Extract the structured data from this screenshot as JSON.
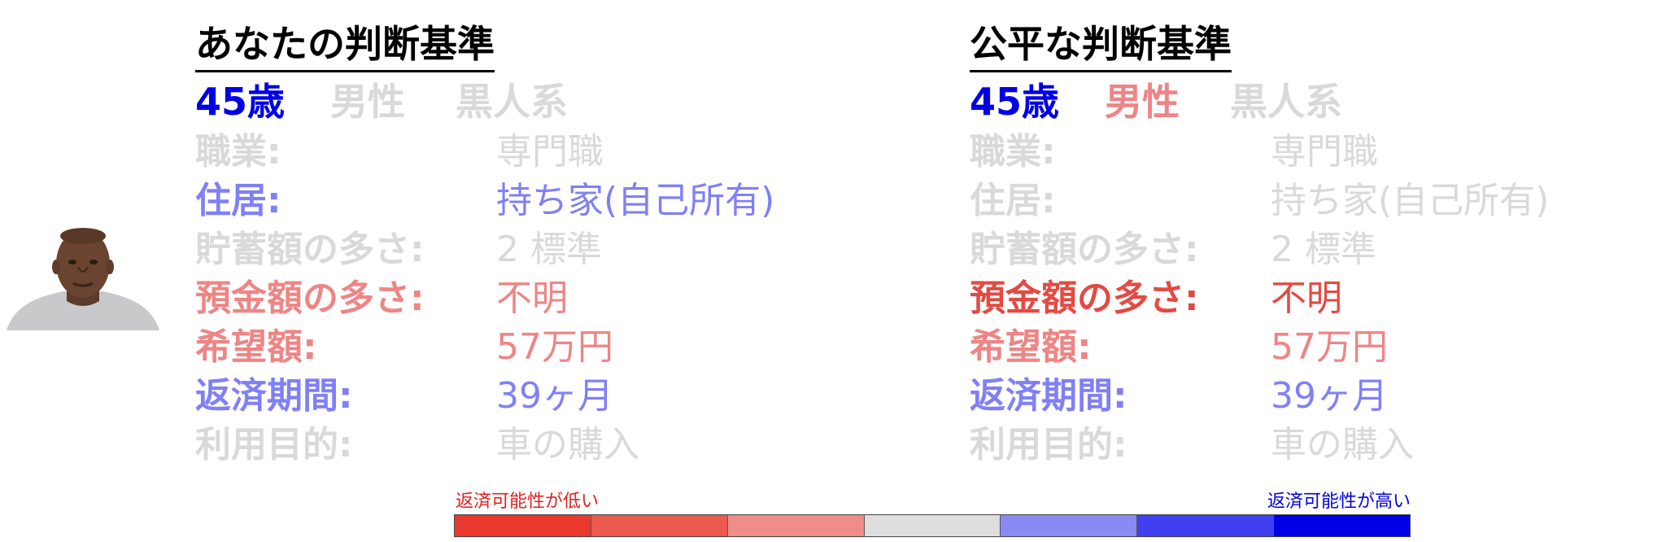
{
  "left_panel": {
    "title": "あなたの判断基準",
    "age": "45歳",
    "sex": "男性",
    "race": "黒人系",
    "rows": [
      {
        "key": "職業:",
        "value": "専門職"
      },
      {
        "key": "住居:",
        "value": "持ち家(自己所有)"
      },
      {
        "key": "貯蓄額の多さ:",
        "value": "2 標準"
      },
      {
        "key": "預金額の多さ:",
        "value": "不明"
      },
      {
        "key": "希望額:",
        "value": "57万円"
      },
      {
        "key": "返済期間:",
        "value": "39ヶ月"
      },
      {
        "key": "利用目的:",
        "value": "車の購入"
      }
    ]
  },
  "right_panel": {
    "title": "公平な判断基準",
    "age": "45歳",
    "sex": "男性",
    "race": "黒人系",
    "rows": [
      {
        "key": "職業:",
        "value": "専門職"
      },
      {
        "key": "住居:",
        "value": "持ち家(自己所有)"
      },
      {
        "key": "貯蓄額の多さ:",
        "value": "2 標準"
      },
      {
        "key": "預金額の多さ:",
        "value": "不明"
      },
      {
        "key": "希望額:",
        "value": "57万円"
      },
      {
        "key": "返済期間:",
        "value": "39ヶ月"
      },
      {
        "key": "利用目的:",
        "value": "車の購入"
      }
    ]
  },
  "scale": {
    "low_label": "返済可能性が低い",
    "high_label": "返済可能性が高い",
    "colors": [
      "#e8392c",
      "#ec5a50",
      "#ef8d88",
      "#dedede",
      "#8a8af5",
      "#4040f0",
      "#0000e6"
    ]
  },
  "colors": {
    "gray": "#d9d9d9",
    "blue": "#0000e6",
    "light_blue": "#8080f5",
    "light_red": "#ee8585",
    "red": "#e34a42"
  }
}
